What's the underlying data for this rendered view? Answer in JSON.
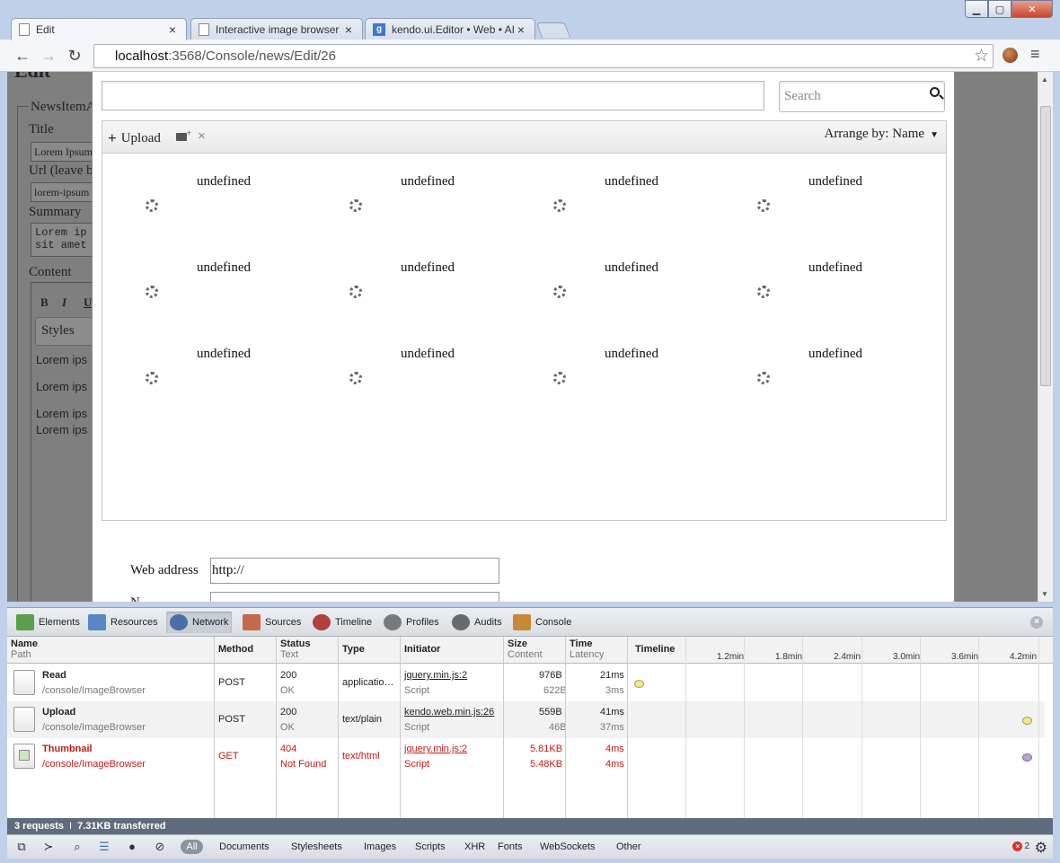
{
  "browser": {
    "tabs": [
      {
        "title": "Edit",
        "icon": "page-icon",
        "active": true
      },
      {
        "title": "Interactive image browser",
        "icon": "page-icon",
        "active": false
      },
      {
        "title": "kendo.ui.Editor • Web • AI",
        "icon": "google-icon",
        "icon_glyph": "g",
        "active": false
      }
    ],
    "tab_close_glyph": "×",
    "window_controls": {
      "minimize": "▁",
      "maximize": "▢",
      "close": "✕"
    },
    "nav": {
      "back": "←",
      "forward": "→",
      "reload": "↻"
    },
    "url_host": "localhost",
    "url_rest": ":3568/Console/news/Edit/26",
    "star_glyph": "☆",
    "menu_glyph": "≡"
  },
  "background_form": {
    "heading": "Edit",
    "legend": "NewsItemA",
    "title_label": "Title",
    "title_value": "Lorem Ipsum",
    "url_label": "Url (leave b",
    "url_value": "lorem-ipsum",
    "summary_label": "Summary",
    "summary_lines": [
      "Lorem ip",
      "sit amet"
    ],
    "content_label": "Content",
    "format_buttons": [
      "B",
      "I",
      "U"
    ],
    "styles_label": "Styles",
    "editor_lines": [
      "Lorem ips",
      "Lorem ips",
      "Lorem ips",
      "Lorem ips"
    ]
  },
  "image_browser": {
    "search_placeholder": "Search",
    "upload_label": "Upload",
    "upload_glyph": "+",
    "delete_glyph": "×",
    "arrange_label": "Arrange by: Name",
    "arrange_caret": "▼",
    "items": [
      "undefined",
      "undefined",
      "undefined",
      "undefined",
      "undefined",
      "undefined",
      "undefined",
      "undefined",
      "undefined",
      "undefined",
      "undefined",
      "undefined"
    ],
    "web_address_label": "Web address",
    "web_address_value": "http://",
    "next_label": "N"
  },
  "devtools": {
    "panels": [
      {
        "label": "Elements",
        "icon": "elements-icon",
        "color": "#5aa04a"
      },
      {
        "label": "Resources",
        "icon": "resources-icon",
        "color": "#5b86c4"
      },
      {
        "label": "Network",
        "icon": "network-icon",
        "color": "#4a6fa8",
        "active": true
      },
      {
        "label": "Sources",
        "icon": "sources-icon",
        "color": "#c46a4a"
      },
      {
        "label": "Timeline",
        "icon": "timeline-icon",
        "color": "#b04040"
      },
      {
        "label": "Profiles",
        "icon": "profiles-icon",
        "color": "#7a7a7a"
      },
      {
        "label": "Audits",
        "icon": "audits-icon",
        "color": "#6a6a6a"
      },
      {
        "label": "Console",
        "icon": "console-icon",
        "color": "#c48a3a"
      }
    ],
    "close_glyph": "×",
    "columns": {
      "name": "Name",
      "path": "Path",
      "method": "Method",
      "status": "Status",
      "status_sub": "Text",
      "type": "Type",
      "initiator": "Initiator",
      "size": "Size",
      "size_sub": "Content",
      "time": "Time",
      "time_sub": "Latency",
      "timeline": "Timeline"
    },
    "ticks": [
      "1.2min",
      "1.8min",
      "2.4min",
      "3.0min",
      "3.6min",
      "4.2min"
    ],
    "requests": [
      {
        "name": "Read",
        "path": "/console/ImageBrowser",
        "method": "POST",
        "status": "200",
        "status_text": "OK",
        "type": "applicatio…",
        "initiator": "jquery.min.js:2",
        "initiator_type": "Script",
        "size": "976B",
        "content": "622B",
        "time": "21ms",
        "latency": "3ms",
        "dot_color": "#f2e98a",
        "error": false
      },
      {
        "name": "Upload",
        "path": "/console/ImageBrowser",
        "method": "POST",
        "status": "200",
        "status_text": "OK",
        "type": "text/plain",
        "initiator": "kendo.web.min.js:26",
        "initiator_type": "Script",
        "size": "559B",
        "content": "46B",
        "time": "41ms",
        "latency": "37ms",
        "dot_color": "#f2e98a",
        "error": false
      },
      {
        "name": "Thumbnail",
        "path": "/console/ImageBrowser",
        "method": "GET",
        "status": "404",
        "status_text": "Not Found",
        "type": "text/html",
        "initiator": "jquery.min.js:2",
        "initiator_type": "Script",
        "size": "5.81KB",
        "content": "5.48KB",
        "time": "4ms",
        "latency": "4ms",
        "dot_color": "#b9a6d8",
        "error": true
      }
    ],
    "summary_requests": "3 requests",
    "summary_sep": "I",
    "summary_transferred": "7.31KB transferred",
    "filters": [
      "Documents",
      "Stylesheets",
      "Images",
      "Scripts",
      "XHR",
      "Fonts",
      "WebSockets",
      "Other"
    ],
    "filter_all": "All",
    "error_count": "2",
    "gear_glyph": "⚙"
  }
}
